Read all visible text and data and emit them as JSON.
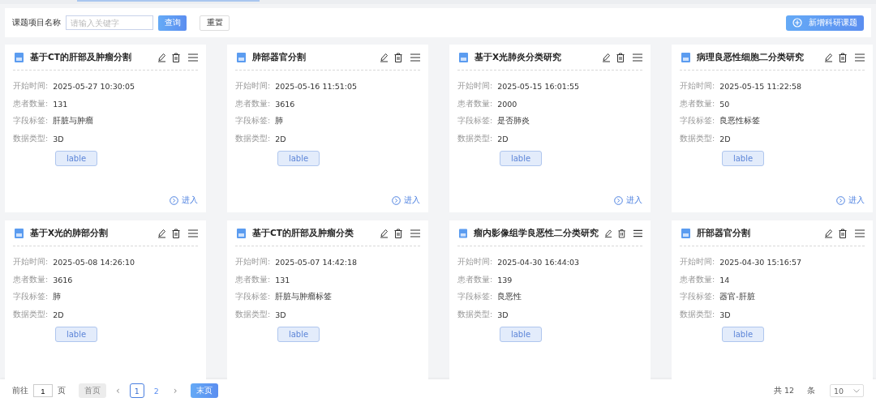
{
  "search": {
    "label": "课题项目名称",
    "placeholder": "请输入关键字",
    "query_button": "查询",
    "reset_button": "重置",
    "add_button": "新增科研课题"
  },
  "cards": [
    {
      "title": "基于CT的肝部及肿瘤分割",
      "fields": [
        {
          "label": "开始时间:",
          "value": "2025-05-27 10:30:05"
        },
        {
          "label": "患者数量:",
          "value": "131"
        },
        {
          "label": "字段标签:",
          "value": "肝脏与肿瘤"
        },
        {
          "label": "数据类型:",
          "value": "3D"
        }
      ],
      "tag": "lable",
      "enter": "进入"
    },
    {
      "title": "肺部器官分割",
      "fields": [
        {
          "label": "开始时间:",
          "value": "2025-05-16 11:51:05"
        },
        {
          "label": "患者数量:",
          "value": "3616"
        },
        {
          "label": "字段标签:",
          "value": "肺"
        },
        {
          "label": "数据类型:",
          "value": "2D"
        }
      ],
      "tag": "lable",
      "enter": "进入"
    },
    {
      "title": "基于X光肺炎分类研究",
      "fields": [
        {
          "label": "开始时间:",
          "value": "2025-05-15 16:01:55"
        },
        {
          "label": "患者数量:",
          "value": "2000"
        },
        {
          "label": "字段标签:",
          "value": "是否肺炎"
        },
        {
          "label": "数据类型:",
          "value": "2D"
        }
      ],
      "tag": "lable",
      "enter": "进入"
    },
    {
      "title": "病理良恶性细胞二分类研究",
      "fields": [
        {
          "label": "开始时间:",
          "value": "2025-05-15 11:22:58"
        },
        {
          "label": "患者数量:",
          "value": "50"
        },
        {
          "label": "字段标签:",
          "value": "良恶性标签"
        },
        {
          "label": "数据类型:",
          "value": "2D"
        }
      ],
      "tag": "lable",
      "enter": "进入"
    },
    {
      "title": "基于X光的肺部分割",
      "fields": [
        {
          "label": "开始时间:",
          "value": "2025-05-08 14:26:10"
        },
        {
          "label": "患者数量:",
          "value": "3616"
        },
        {
          "label": "字段标签:",
          "value": "肺"
        },
        {
          "label": "数据类型:",
          "value": "2D"
        }
      ],
      "tag": "lable"
    },
    {
      "title": "基于CT的肝部及肿瘤分类",
      "fields": [
        {
          "label": "开始时间:",
          "value": "2025-05-07 14:42:18"
        },
        {
          "label": "患者数量:",
          "value": "131"
        },
        {
          "label": "字段标签:",
          "value": "肝脏与肿瘤标签"
        },
        {
          "label": "数据类型:",
          "value": "3D"
        }
      ],
      "tag": "lable"
    },
    {
      "title": "瘤内影像组学良恶性二分类研究",
      "fields": [
        {
          "label": "开始时间:",
          "value": "2025-04-30 16:44:03"
        },
        {
          "label": "患者数量:",
          "value": "139"
        },
        {
          "label": "字段标签:",
          "value": "良恶性"
        },
        {
          "label": "数据类型:",
          "value": "3D"
        }
      ],
      "tag": "lable"
    },
    {
      "title": "肝部器官分割",
      "fields": [
        {
          "label": "开始时间:",
          "value": "2025-04-30 15:16:57"
        },
        {
          "label": "患者数量:",
          "value": "14"
        },
        {
          "label": "字段标签:",
          "value": "器官-肝脏"
        },
        {
          "label": "数据类型:",
          "value": "3D"
        }
      ],
      "tag": "lable"
    }
  ],
  "pagination": {
    "goto_label": "前往",
    "goto_value": "1",
    "goto_unit": "页",
    "first": {
      "label": "首页",
      "disabled": true
    },
    "prev": "‹",
    "pages": [
      {
        "label": "1",
        "selected": true
      },
      {
        "label": "2",
        "selected": false
      }
    ],
    "next": "›",
    "last": {
      "label": "末页",
      "disabled": false
    },
    "total": "共 12",
    "total_unit": "条",
    "page_size": "10"
  }
}
